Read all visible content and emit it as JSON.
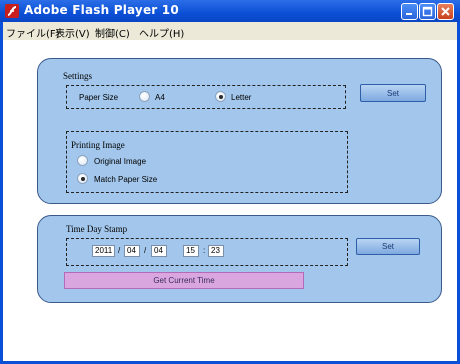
{
  "window": {
    "title": "Adobe Flash Player 10",
    "icon": "flash-icon",
    "controls": [
      "minimize-icon",
      "maximize-icon",
      "close-icon"
    ]
  },
  "menu": {
    "items": [
      "ファイル(F)",
      "表示(V)",
      "制御(C)",
      "ヘルプ(H)"
    ]
  },
  "settings": {
    "heading": "Settings",
    "paper_size_label": "Paper Size",
    "options": [
      {
        "label": "A4",
        "selected": false
      },
      {
        "label": "Letter",
        "selected": true
      }
    ],
    "set_label": "Set"
  },
  "printing": {
    "heading": "Printing Image",
    "options": [
      {
        "label": "Original Image",
        "selected": false
      },
      {
        "label": "Match Paper Size",
        "selected": true
      }
    ]
  },
  "timestamp": {
    "heading": "Time Day Stamp",
    "year": "2011",
    "month": "04",
    "day": "04",
    "hour": "15",
    "minute": "23",
    "sep1": "/",
    "sep2": "/",
    "sep3": ":",
    "set_label": "Set",
    "get_time_label": "Get Current Time"
  },
  "colors": {
    "panel": "#a3c7ec",
    "titlebar": "#0b4fd6",
    "get_time_button": "#d9a6df"
  }
}
